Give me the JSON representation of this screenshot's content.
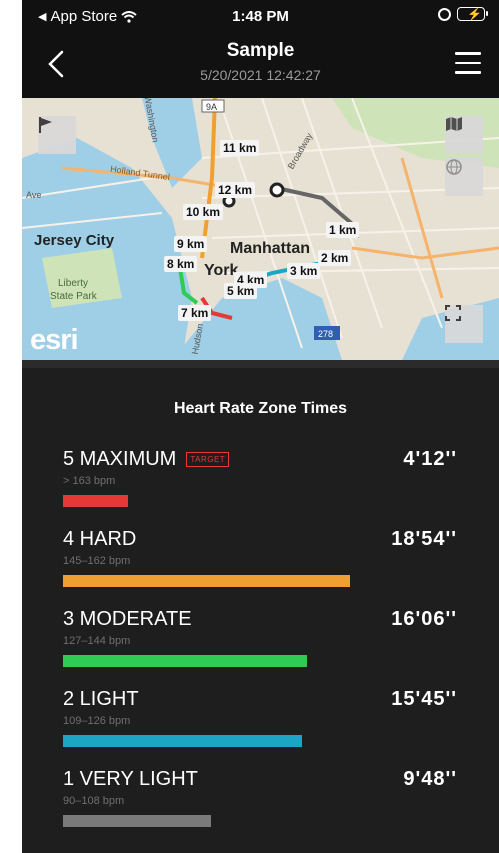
{
  "status_bar": {
    "back_app": "App Store",
    "time": "1:48 PM"
  },
  "nav": {
    "title": "Sample",
    "subtitle": "5/20/2021 12:42:27"
  },
  "map": {
    "attribution": "esri",
    "labels": [
      "Jersey City",
      "Manhattan",
      "Liberty",
      "State Park",
      "York",
      "Ave",
      "Holland Tunnel",
      "Broadway",
      "Washington",
      "Hudson"
    ],
    "km_markers": [
      "11 km",
      "12 km",
      "10 km",
      "1 km",
      "9 km",
      "2 km",
      "8 km",
      "3 km",
      "4 km",
      "5 km",
      "7 km"
    ],
    "road_shields": [
      "9A",
      "278"
    ]
  },
  "zones_heading": "Heart Rate Zone Times",
  "target_label": "TARGET",
  "zones": [
    {
      "name": "5 MAXIMUM",
      "range": "> 163 bpm",
      "time": "4'12''",
      "color": "#e53935",
      "fraction": 0.15
    },
    {
      "name": "4 HARD",
      "range": "145–162 bpm",
      "time": "18'54''",
      "color": "#f0a030",
      "fraction": 0.66
    },
    {
      "name": "3 MODERATE",
      "range": "127–144 bpm",
      "time": "16'06''",
      "color": "#2ecc55",
      "fraction": 0.56
    },
    {
      "name": "2 LIGHT",
      "range": "109–126 bpm",
      "time": "15'45''",
      "color": "#1aa6c4",
      "fraction": 0.55
    },
    {
      "name": "1 VERY LIGHT",
      "range": "90–108 bpm",
      "time": "9'48''",
      "color": "#7a7a7a",
      "fraction": 0.34
    }
  ]
}
